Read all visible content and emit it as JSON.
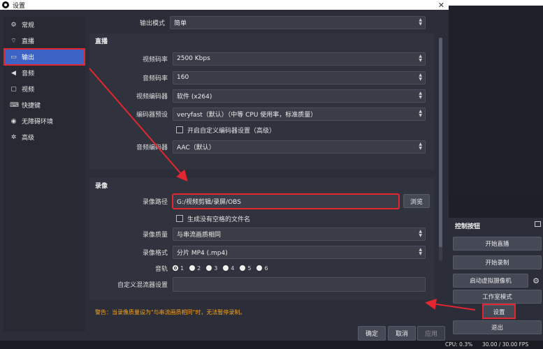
{
  "window": {
    "title": "设置",
    "close_glyph": "✕"
  },
  "sidebar": {
    "items": [
      {
        "label": "常规",
        "icon": "gear-icon",
        "glyph": "✿"
      },
      {
        "label": "直播",
        "icon": "antenna-icon",
        "glyph": "📶"
      },
      {
        "label": "输出",
        "icon": "output-icon",
        "glyph": "▭",
        "active": true
      },
      {
        "label": "音频",
        "icon": "speaker-icon",
        "glyph": "🔊"
      },
      {
        "label": "视频",
        "icon": "monitor-icon",
        "glyph": "▢"
      },
      {
        "label": "快捷键",
        "icon": "keyboard-icon",
        "glyph": "⌨"
      },
      {
        "label": "无障碍环境",
        "icon": "accessibility-icon",
        "glyph": "♿"
      },
      {
        "label": "高级",
        "icon": "wrench-icon",
        "glyph": "✲"
      }
    ]
  },
  "output_mode": {
    "label": "输出模式",
    "value": "简单"
  },
  "streaming": {
    "title": "直播",
    "video_bitrate": {
      "label": "视频码率",
      "value": "2500 Kbps"
    },
    "audio_bitrate": {
      "label": "音频码率",
      "value": "160"
    },
    "video_encoder": {
      "label": "视频编码器",
      "value": "软件 (x264)"
    },
    "encoder_preset": {
      "label": "编码器预设",
      "value": "veryfast（默认）（中等 CPU 使用率，标准质量）"
    },
    "custom_encoder_checkbox": "开启自定义编码器设置（高级）",
    "audio_encoder": {
      "label": "音频编码器",
      "value": "AAC（默认）"
    }
  },
  "recording": {
    "title": "录像",
    "path": {
      "label": "录像路径",
      "value": "G:/视频剪辑/录屏/OBS",
      "browse": "浏览"
    },
    "no_space_checkbox": "生成没有空格的文件名",
    "quality": {
      "label": "录像质量",
      "value": "与串流画质相同"
    },
    "format": {
      "label": "录像格式",
      "value": "分片 MP4 (.mp4)"
    },
    "tracks": {
      "label": "音轨",
      "options": [
        "1",
        "2",
        "3",
        "4",
        "5",
        "6"
      ],
      "selected": "1"
    },
    "muxer": {
      "label": "自定义混流器设置",
      "value": ""
    }
  },
  "warning": "警告：当录像质量设为\"与串流画质相同\"时，无法暂停录制。",
  "footer": {
    "ok": "确定",
    "cancel": "取消",
    "apply": "应用"
  },
  "controls": {
    "title": "控制按钮",
    "start_stream": "开始直播",
    "start_record": "开始录制",
    "virtual_cam": "启动虚拟摄像机",
    "studio_mode": "工作室模式",
    "settings": "设置",
    "exit": "退出"
  },
  "statusbar": {
    "cpu": "CPU: 0.3%",
    "fps": "30.00 / 30.00 FPS"
  },
  "colors": {
    "accent": "#3d63c4",
    "highlight": "#e3262f",
    "warning": "#f7a21b"
  }
}
